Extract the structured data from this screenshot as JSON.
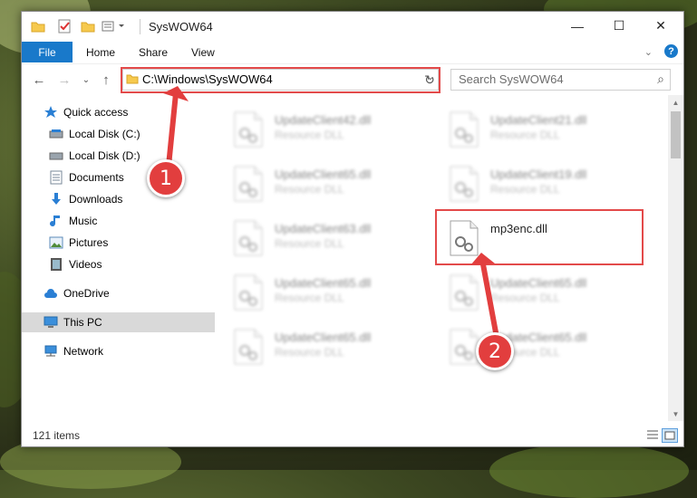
{
  "window": {
    "title": "SysWOW64",
    "minimize_glyph": "—",
    "maximize_glyph": "☐",
    "close_glyph": "✕"
  },
  "ribbon": {
    "tabs": [
      "File",
      "Home",
      "Share",
      "View"
    ],
    "help_label": "?"
  },
  "navbar": {
    "address": "C:\\Windows\\SysWOW64",
    "search_placeholder": "Search SysWOW64"
  },
  "sidebar": {
    "items": [
      {
        "label": "Quick access",
        "icon": "star-icon"
      },
      {
        "label": "Local Disk (C:)",
        "icon": "drive-icon"
      },
      {
        "label": "Local Disk (D:)",
        "icon": "drive-icon"
      },
      {
        "label": "Documents",
        "icon": "documents-icon"
      },
      {
        "label": "Downloads",
        "icon": "download-icon"
      },
      {
        "label": "Music",
        "icon": "music-icon"
      },
      {
        "label": "Pictures",
        "icon": "pictures-icon"
      },
      {
        "label": "Videos",
        "icon": "videos-icon"
      },
      {
        "label": "OneDrive",
        "icon": "cloud-icon"
      },
      {
        "label": "This PC",
        "icon": "computer-icon"
      },
      {
        "label": "Network",
        "icon": "network-icon"
      }
    ]
  },
  "files": [
    {
      "name": "UpdateClient42.dll",
      "type": "Resource DLL"
    },
    {
      "name": "UpdateClient21.dll",
      "type": "Resource DLL"
    },
    {
      "name": "UpdateClient65.dll",
      "type": "Resource DLL"
    },
    {
      "name": "UpdateClient19.dll",
      "type": "Resource DLL"
    },
    {
      "name": "UpdateClient63.dll",
      "type": "Resource DLL"
    },
    {
      "name": "mp3enc.dll",
      "type": ""
    },
    {
      "name": "UpdateClient65.dll",
      "type": "Resource DLL"
    },
    {
      "name": "UpdateClient65.dll",
      "type": "Resource DLL"
    },
    {
      "name": "UpdateClient65.dll",
      "type": "Resource DLL"
    },
    {
      "name": "UpdateClient65.dll",
      "type": "Resource DLL"
    }
  ],
  "status": {
    "item_count": "121 items"
  },
  "callouts": {
    "step1": "1",
    "step2": "2"
  },
  "colors": {
    "accent": "#1979ca",
    "highlight": "#e34a4a",
    "badge": "#e23e3e",
    "selected": "#d9d9d9"
  }
}
